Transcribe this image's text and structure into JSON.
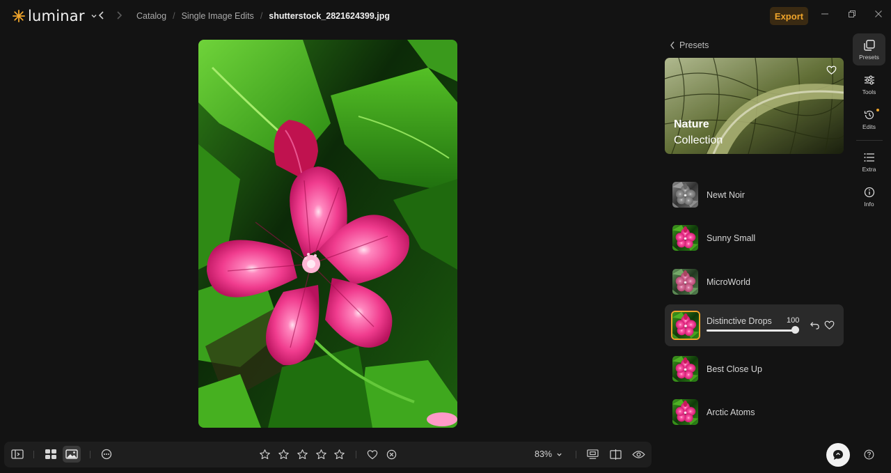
{
  "app": {
    "logo_text": "luminar",
    "accent": "#f0a52b"
  },
  "breadcrumb": {
    "items": [
      "Catalog",
      "Single Image Edits"
    ],
    "separator": "/",
    "current": "shutterstock_2821624399.jpg"
  },
  "header": {
    "export_label": "Export"
  },
  "panel": {
    "back_label": "Presets",
    "collection": {
      "title": "Nature",
      "subtitle": "Collection"
    },
    "presets": [
      {
        "name": "Newt Noir",
        "thumb": "mono"
      },
      {
        "name": "Sunny Small",
        "thumb": "color"
      },
      {
        "name": "MicroWorld",
        "thumb": "soft"
      },
      {
        "name": "Distinctive Drops",
        "thumb": "color",
        "active": true,
        "amount": "100",
        "level": 1.0
      },
      {
        "name": "Best Close Up",
        "thumb": "color"
      },
      {
        "name": "Arctic Atoms",
        "thumb": "color"
      }
    ]
  },
  "rail": {
    "items": [
      {
        "label": "Presets",
        "icon": "presets-icon",
        "active": true
      },
      {
        "label": "Tools",
        "icon": "sliders-icon"
      },
      {
        "label": "Edits",
        "icon": "history-icon",
        "dot": true
      },
      {
        "label": "Extra",
        "icon": "list-icon"
      },
      {
        "label": "Info",
        "icon": "info-icon"
      }
    ]
  },
  "bottom": {
    "zoom": "83%",
    "rating_stars": 0
  }
}
